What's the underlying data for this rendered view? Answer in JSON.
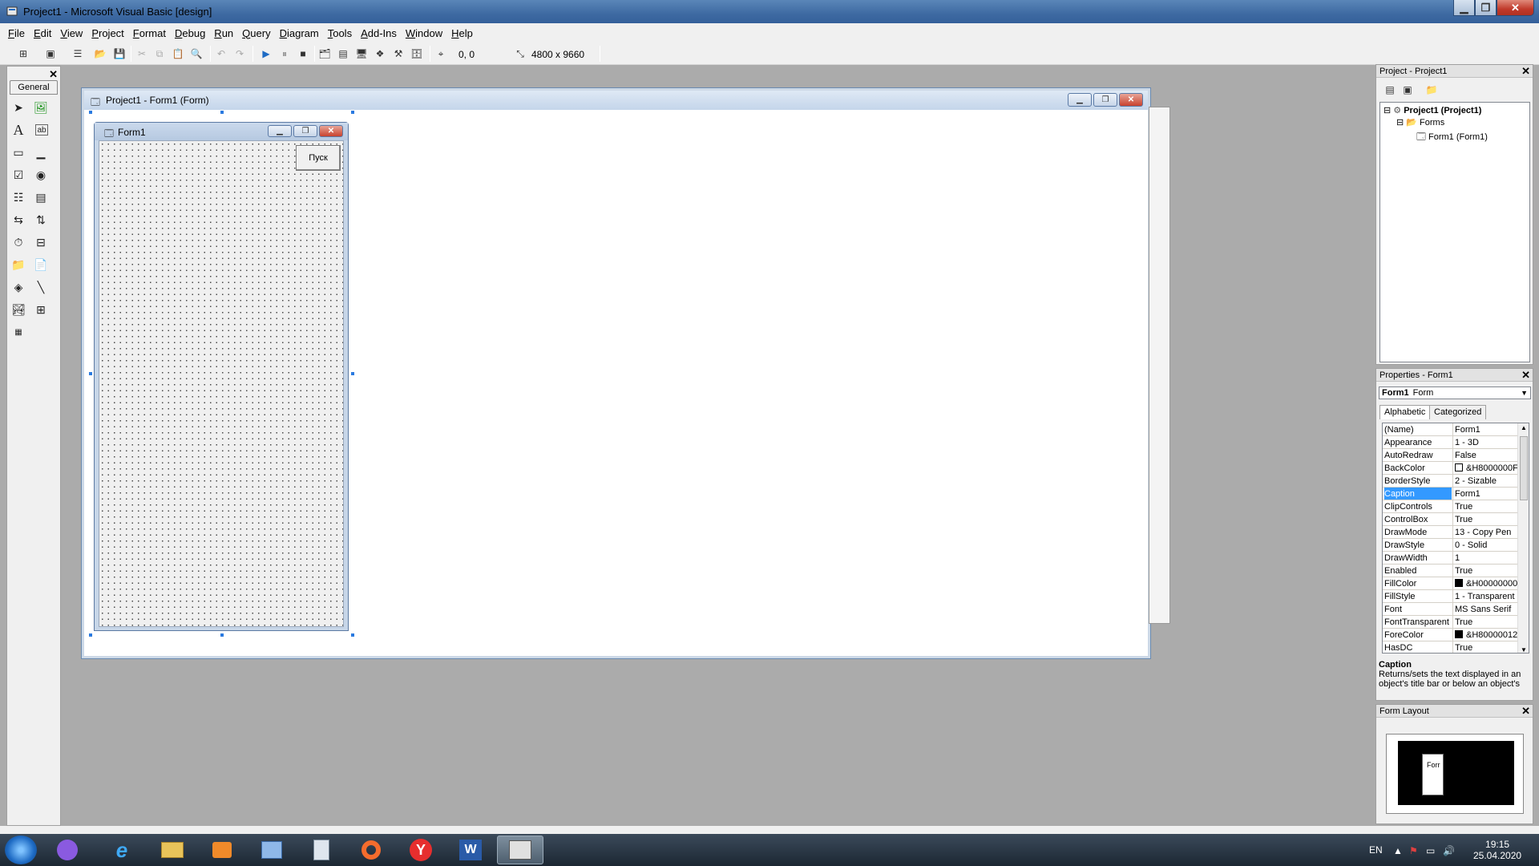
{
  "window": {
    "title": "Project1 - Microsoft Visual Basic [design]"
  },
  "menu": [
    "File",
    "Edit",
    "View",
    "Project",
    "Format",
    "Debug",
    "Run",
    "Query",
    "Diagram",
    "Tools",
    "Add-Ins",
    "Window",
    "Help"
  ],
  "toolbar": {
    "coords": "0, 0",
    "size": "4800 x 9660"
  },
  "toolbox": {
    "tab_label": "General"
  },
  "designer": {
    "title": "Project1 - Form1 (Form)"
  },
  "form1": {
    "title": "Form1",
    "button_label": "Пуск"
  },
  "project_panel": {
    "title": "Project - Project1",
    "tree": [
      {
        "label": "Project1 (Project1)",
        "bold": true
      },
      {
        "label": "Forms"
      },
      {
        "label": "Form1 (Form1)"
      }
    ]
  },
  "properties_panel": {
    "title": "Properties - Form1",
    "object_name": "Form1",
    "object_type": "Form",
    "tabs": [
      "Alphabetic",
      "Categorized"
    ],
    "rows": [
      {
        "name": "(Name)",
        "value": "Form1"
      },
      {
        "name": "Appearance",
        "value": "1 - 3D"
      },
      {
        "name": "AutoRedraw",
        "value": "False"
      },
      {
        "name": "BackColor",
        "value": "&H8000000F",
        "swatch": "#ffffff"
      },
      {
        "name": "BorderStyle",
        "value": "2 - Sizable"
      },
      {
        "name": "Caption",
        "value": "Form1",
        "selected": true
      },
      {
        "name": "ClipControls",
        "value": "True"
      },
      {
        "name": "ControlBox",
        "value": "True"
      },
      {
        "name": "DrawMode",
        "value": "13 - Copy Pen"
      },
      {
        "name": "DrawStyle",
        "value": "0 - Solid"
      },
      {
        "name": "DrawWidth",
        "value": "1"
      },
      {
        "name": "Enabled",
        "value": "True"
      },
      {
        "name": "FillColor",
        "value": "&H00000000",
        "swatch": "#000000"
      },
      {
        "name": "FillStyle",
        "value": "1 - Transparent"
      },
      {
        "name": "Font",
        "value": "MS Sans Serif"
      },
      {
        "name": "FontTransparent",
        "value": "True"
      },
      {
        "name": "ForeColor",
        "value": "&H80000012",
        "swatch": "#000000"
      },
      {
        "name": "HasDC",
        "value": "True"
      }
    ],
    "desc_title": "Caption",
    "desc_text": "Returns/sets the text displayed in an object's title bar or below an object's"
  },
  "layout_panel": {
    "title": "Form Layout",
    "form_label": "Forr"
  },
  "taskbar": {
    "lang": "EN",
    "time": "19:15",
    "date": "25.04.2020"
  },
  "colors": {
    "selection": "#3399ff",
    "titlebar": "#3e6aa2",
    "close": "#c0392b"
  }
}
